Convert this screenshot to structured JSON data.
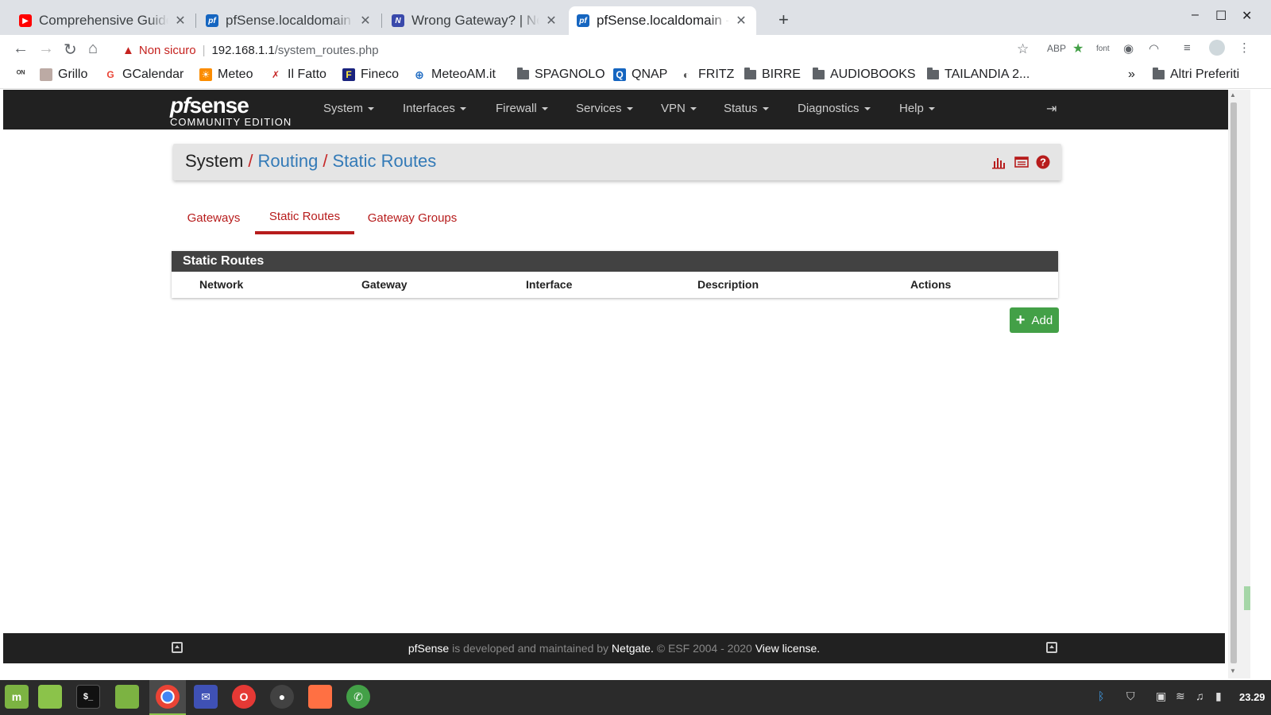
{
  "browser": {
    "tabs": [
      {
        "title": "Comprehensive Guide t",
        "favicon": "youtube-icon",
        "color": "#ff0000",
        "active": false
      },
      {
        "title": "pfSense.localdomain - I",
        "favicon": "pfsense-icon",
        "color": "#1565c0",
        "active": false
      },
      {
        "title": "Wrong Gateway? | Net",
        "favicon": "netgate-icon",
        "color": "#3949ab",
        "active": false
      },
      {
        "title": "pfSense.localdomain - S",
        "favicon": "pfsense-icon",
        "color": "#1565c0",
        "active": true
      }
    ],
    "new_tab": "+",
    "window_controls": {
      "minimize": "–",
      "maximize": "☐",
      "close": "✕"
    },
    "address": {
      "warning": "Non sicuro",
      "host": "192.168.1.1",
      "path": "/system_routes.php"
    },
    "bookmarks": [
      {
        "label": "Grillo",
        "icon": "grillo-icon"
      },
      {
        "label": "GCalendar",
        "icon": "google-icon"
      },
      {
        "label": "Meteo",
        "icon": "meteo-icon"
      },
      {
        "label": "Il Fatto",
        "icon": "ilfatto-icon"
      },
      {
        "label": "Fineco",
        "icon": "fineco-icon"
      },
      {
        "label": "MeteoAM.it",
        "icon": "globe-icon"
      },
      {
        "label": "SPAGNOLO",
        "icon": "folder-icon"
      },
      {
        "label": "QNAP",
        "icon": "qnap-icon"
      },
      {
        "label": "FRITZ",
        "icon": "fritz-icon"
      },
      {
        "label": "BIRRE",
        "icon": "folder-icon"
      },
      {
        "label": "AUDIOBOOKS",
        "icon": "folder-icon"
      },
      {
        "label": "TAILANDIA 2...",
        "icon": "folder-icon"
      }
    ],
    "bookmarks_overflow": "»",
    "other_bookmarks": "Altri Preferiti"
  },
  "pfsense": {
    "logo": {
      "pf": "pf",
      "sense": "sense",
      "edition": "COMMUNITY EDITION"
    },
    "menu": [
      "System",
      "Interfaces",
      "Firewall",
      "Services",
      "VPN",
      "Status",
      "Diagnostics",
      "Help"
    ],
    "breadcrumb": {
      "root": "System",
      "level1": "Routing",
      "level2": "Static Routes",
      "separator": "/"
    },
    "tabs": [
      {
        "label": "Gateways",
        "active": false
      },
      {
        "label": "Static Routes",
        "active": true
      },
      {
        "label": "Gateway Groups",
        "active": false
      }
    ],
    "panel": {
      "title": "Static Routes",
      "columns": [
        "Network",
        "Gateway",
        "Interface",
        "Description",
        "Actions"
      ],
      "rows": []
    },
    "add_button": {
      "icon": "+",
      "label": "Add"
    },
    "footer": {
      "brand": "pfSense",
      "text1": "is developed and maintained by",
      "company": "Netgate.",
      "text2": "© ESF 2004 - 2020",
      "license": "View license."
    },
    "colors": {
      "accent": "#b71c1c",
      "link": "#337ab7",
      "nav_bg": "#212121",
      "add_green": "#43a047"
    }
  },
  "taskbar": {
    "apps": [
      "mint-menu-icon",
      "files-green-icon",
      "terminal-icon",
      "folder-icon",
      "chrome-icon",
      "mail-icon",
      "opera-icon",
      "webcam-icon",
      "firefox-icon",
      "whatsapp-icon"
    ],
    "terminal_label": "$_",
    "clock": "23.29"
  }
}
